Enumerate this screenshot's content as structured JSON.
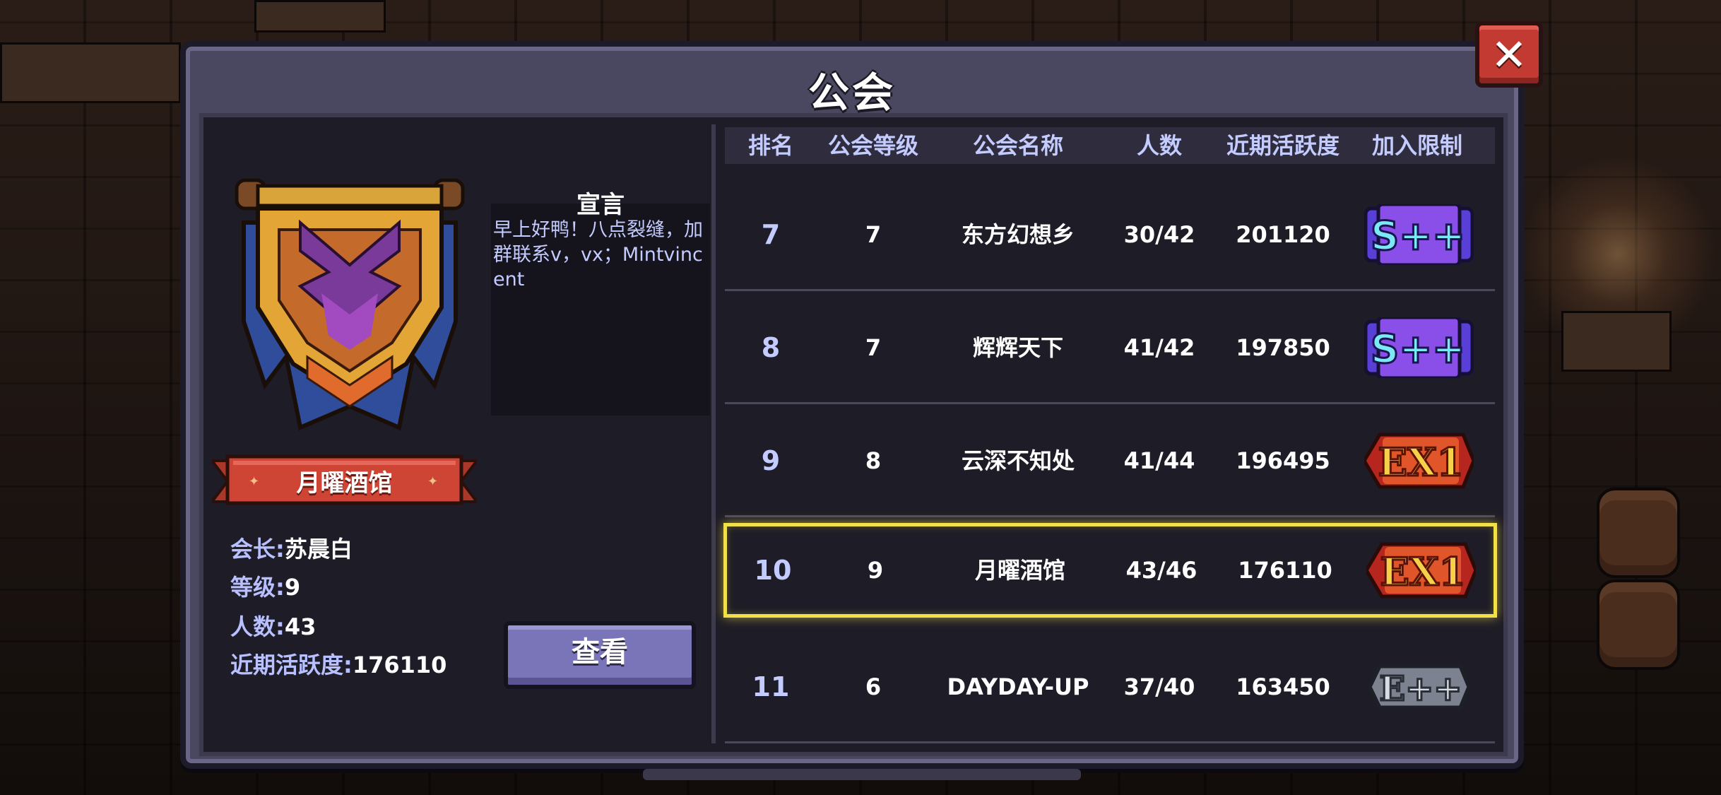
{
  "title": "公会",
  "close_label": "✕",
  "guild": {
    "name": "月曜酒馆",
    "leader_label": "会长:",
    "leader": "苏晨白",
    "level_label": "等级:",
    "level": "9",
    "members_label": "人数:",
    "members": "43",
    "activity_label": "近期活跃度:",
    "activity": "176110",
    "manifesto_label": "宣言",
    "manifesto": "早上好鸭！八点裂缝，加群联系v，vx；Mintvincent",
    "view_button": "查看"
  },
  "table": {
    "headers": [
      "排名",
      "公会等级",
      "公会名称",
      "人数",
      "近期活跃度",
      "加入限制"
    ],
    "rows": [
      {
        "rank": "7",
        "level": "7",
        "name": "东方幻想乡",
        "members": "30/42",
        "activity": "201120",
        "limit": "S++",
        "limit_icon": "s-plus-plus-badge-icon"
      },
      {
        "rank": "8",
        "level": "7",
        "name": "辉辉天下",
        "members": "41/42",
        "activity": "197850",
        "limit": "S++",
        "limit_icon": "s-plus-plus-badge-icon"
      },
      {
        "rank": "9",
        "level": "8",
        "name": "云深不知处",
        "members": "41/44",
        "activity": "196495",
        "limit": "EX1",
        "limit_icon": "ex1-badge-icon"
      },
      {
        "rank": "10",
        "level": "9",
        "name": "月曜酒馆",
        "members": "43/46",
        "activity": "176110",
        "limit": "EX1",
        "limit_icon": "ex1-badge-icon",
        "highlighted": true
      },
      {
        "rank": "11",
        "level": "6",
        "name": "DAYDAY-UP",
        "members": "37/40",
        "activity": "163450",
        "limit": "E++",
        "limit_icon": "e-plus-plus-badge-icon"
      }
    ]
  },
  "colors": {
    "panel": "#4a4760",
    "inner": "#1e1c26",
    "accent_text": "#c3cbff",
    "highlight": "#f2e04a",
    "close": "#c33a33",
    "view_button": "#7a74b8"
  }
}
